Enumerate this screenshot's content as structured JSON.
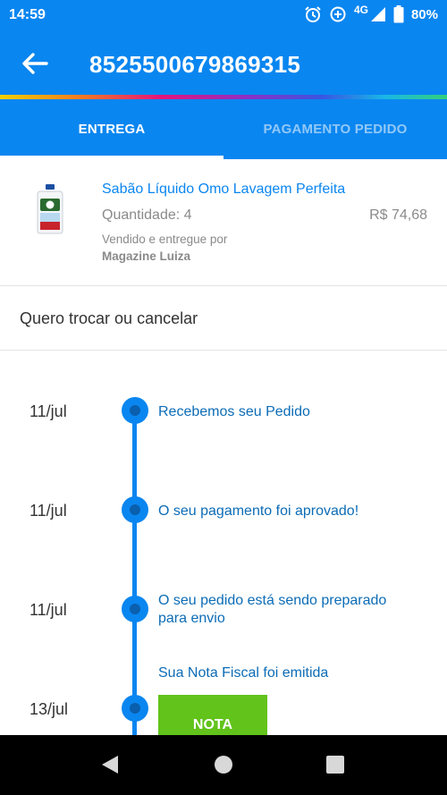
{
  "status_bar": {
    "time": "14:59",
    "network": "4G",
    "battery": "80%",
    "icons": [
      "alarm-icon",
      "data-saver-icon",
      "signal-icon",
      "battery-icon"
    ]
  },
  "app_bar": {
    "back_icon": "arrow-left-icon",
    "order_number": "8525500679869315"
  },
  "tabs": [
    {
      "label": "ENTREGA",
      "active": true
    },
    {
      "label": "PAGAMENTO PEDIDO",
      "active": false
    }
  ],
  "product": {
    "name": "Sabão Líquido Omo Lavagem Perfeita",
    "quantity": "Quantidade: 4",
    "price": "R$ 74,68",
    "sold_by_label": "Vendido e entregue por",
    "seller": "Magazine Luiza"
  },
  "exchange": {
    "label": "Quero trocar ou cancelar"
  },
  "timeline": [
    {
      "date": "11/jul",
      "text": "Recebemos seu Pedido"
    },
    {
      "date": "11/jul",
      "text": "O seu pagamento foi aprovado!"
    },
    {
      "date": "11/jul",
      "text": "O seu pedido está sendo preparado para envio"
    },
    {
      "date": "13/jul",
      "text": "Sua Nota Fiscal foi emitida",
      "button": "NOTA"
    }
  ],
  "colors": {
    "primary": "#0a86f0",
    "timeline_text": "#0c6cb6",
    "nota_button": "#62c31b"
  }
}
